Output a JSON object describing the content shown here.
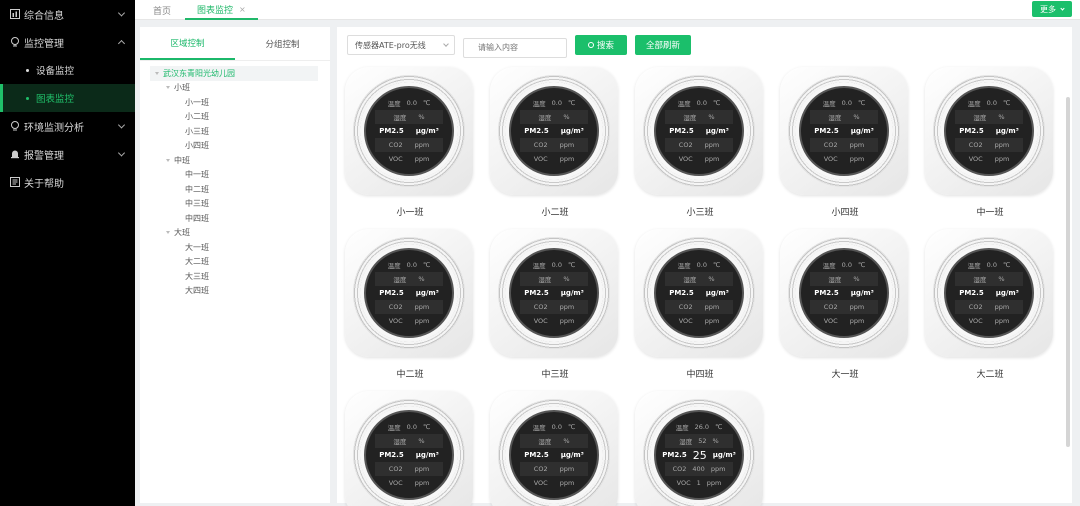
{
  "sidebar": {
    "items": [
      {
        "label": "综合信息",
        "icon": "dashboard-icon",
        "expanded": false
      },
      {
        "label": "监控管理",
        "icon": "monitor-icon",
        "expanded": true,
        "children": [
          {
            "label": "设备监控",
            "active": false
          },
          {
            "label": "图表监控",
            "active": true
          }
        ]
      },
      {
        "label": "环境监测分析",
        "icon": "environment-icon",
        "expanded": false
      },
      {
        "label": "报警管理",
        "icon": "alarm-icon",
        "expanded": false
      },
      {
        "label": "关于帮助",
        "icon": "help-icon",
        "expanded": false
      }
    ]
  },
  "tabs": [
    {
      "label": "首页",
      "active": false
    },
    {
      "label": "图表监控",
      "active": true,
      "close": "×"
    }
  ],
  "more_label": "更多",
  "tree_tabs": [
    {
      "label": "区域控制",
      "active": true
    },
    {
      "label": "分组控制",
      "active": false
    }
  ],
  "tree": {
    "root": "武汉东青阳光幼儿园",
    "groups": [
      {
        "label": "小班",
        "children": [
          "小一班",
          "小二班",
          "小三班",
          "小四班"
        ]
      },
      {
        "label": "中班",
        "children": [
          "中一班",
          "中二班",
          "中三班",
          "中四班"
        ]
      },
      {
        "label": "大班",
        "children": [
          "大一班",
          "大二班",
          "大三班",
          "大四班"
        ]
      }
    ]
  },
  "toolbar": {
    "select_value": "传感器ATE-pro无线",
    "search_placeholder": "请输入内容",
    "search_label": "搜索",
    "refresh_label": "全部刷新"
  },
  "screen_labels": {
    "temp": "温度",
    "hum": "湿度",
    "pm": "PM2.5",
    "co2": "CO2",
    "voc": "VOC",
    "temp_unit": "℃",
    "hum_unit": "%",
    "pm_unit": "μg/m³",
    "co2_unit": "ppm",
    "voc_unit": "ppm"
  },
  "devices": [
    {
      "name": "小一班",
      "temp": "0.0",
      "hum": "",
      "pm": "",
      "co2": "",
      "voc": ""
    },
    {
      "name": "小二班",
      "temp": "0.0",
      "hum": "",
      "pm": "",
      "co2": "",
      "voc": ""
    },
    {
      "name": "小三班",
      "temp": "0.0",
      "hum": "",
      "pm": "",
      "co2": "",
      "voc": ""
    },
    {
      "name": "小四班",
      "temp": "0.0",
      "hum": "",
      "pm": "",
      "co2": "",
      "voc": ""
    },
    {
      "name": "中一班",
      "temp": "0.0",
      "hum": "",
      "pm": "",
      "co2": "",
      "voc": ""
    },
    {
      "name": "中二班",
      "temp": "0.0",
      "hum": "",
      "pm": "",
      "co2": "",
      "voc": ""
    },
    {
      "name": "中三班",
      "temp": "0.0",
      "hum": "",
      "pm": "",
      "co2": "",
      "voc": ""
    },
    {
      "name": "中四班",
      "temp": "0.0",
      "hum": "",
      "pm": "",
      "co2": "",
      "voc": ""
    },
    {
      "name": "大一班",
      "temp": "0.0",
      "hum": "",
      "pm": "",
      "co2": "",
      "voc": ""
    },
    {
      "name": "大二班",
      "temp": "0.0",
      "hum": "",
      "pm": "",
      "co2": "",
      "voc": ""
    },
    {
      "name": "",
      "temp": "0.0",
      "hum": "",
      "pm": "",
      "co2": "",
      "voc": ""
    },
    {
      "name": "",
      "temp": "0.0",
      "hum": "",
      "pm": "",
      "co2": "",
      "voc": ""
    },
    {
      "name": "",
      "temp": "26.0",
      "hum": "52",
      "pm": "25",
      "co2": "400",
      "voc": "1"
    }
  ]
}
